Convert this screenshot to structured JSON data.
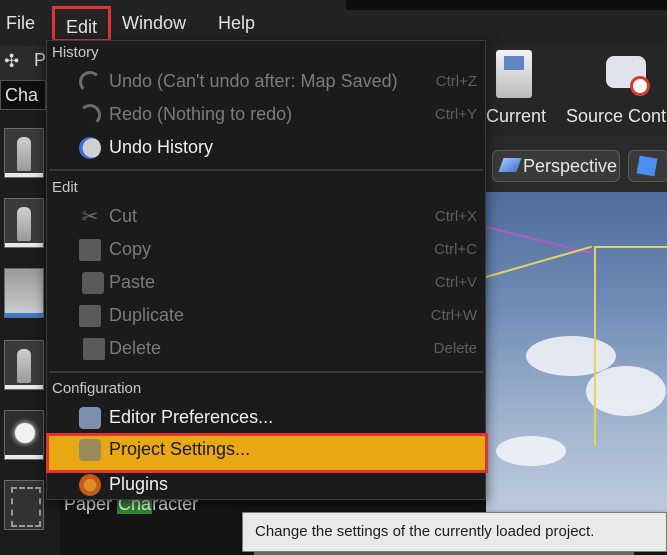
{
  "menubar": {
    "items": [
      "File",
      "Edit",
      "Window",
      "Help"
    ]
  },
  "left_panel": {
    "tab_letter": "P",
    "search_text": "Cha"
  },
  "toolbar": {
    "current_label": "Current",
    "source_label": "Source Contr"
  },
  "viewport": {
    "perspective_label": "Perspective"
  },
  "edit_menu": {
    "sections": {
      "history": "History",
      "edit": "Edit",
      "configuration": "Configuration"
    },
    "items": {
      "undo": {
        "label": "Undo (Can't undo after: Map Saved)",
        "shortcut": "Ctrl+Z",
        "icon": "undo-icon"
      },
      "redo": {
        "label": "Redo (Nothing to redo)",
        "shortcut": "Ctrl+Y",
        "icon": "redo-icon"
      },
      "undo_history": {
        "label": "Undo History",
        "icon": "history-icon"
      },
      "cut": {
        "label": "Cut",
        "shortcut": "Ctrl+X",
        "icon": "scissors-icon"
      },
      "copy": {
        "label": "Copy",
        "shortcut": "Ctrl+C",
        "icon": "copy-icon"
      },
      "paste": {
        "label": "Paste",
        "shortcut": "Ctrl+V",
        "icon": "paste-icon"
      },
      "duplicate": {
        "label": "Duplicate",
        "shortcut": "Ctrl+W",
        "icon": "duplicate-icon"
      },
      "delete": {
        "label": "Delete",
        "shortcut": "Delete",
        "icon": "delete-icon"
      },
      "editor_prefs": {
        "label": "Editor Preferences...",
        "icon": "preferences-icon"
      },
      "project_settings": {
        "label": "Project Settings...",
        "icon": "settings-icon"
      },
      "plugins": {
        "label": "Plugins",
        "icon": "plugin-icon"
      }
    }
  },
  "paper_row": {
    "prefix": "Paper ",
    "highlight": "Cha",
    "suffix": "racter"
  },
  "tooltip": {
    "text": "Change the settings of the currently loaded project."
  },
  "colors": {
    "highlight_bg": "#e8a713",
    "annotation_red": "#e23434"
  }
}
